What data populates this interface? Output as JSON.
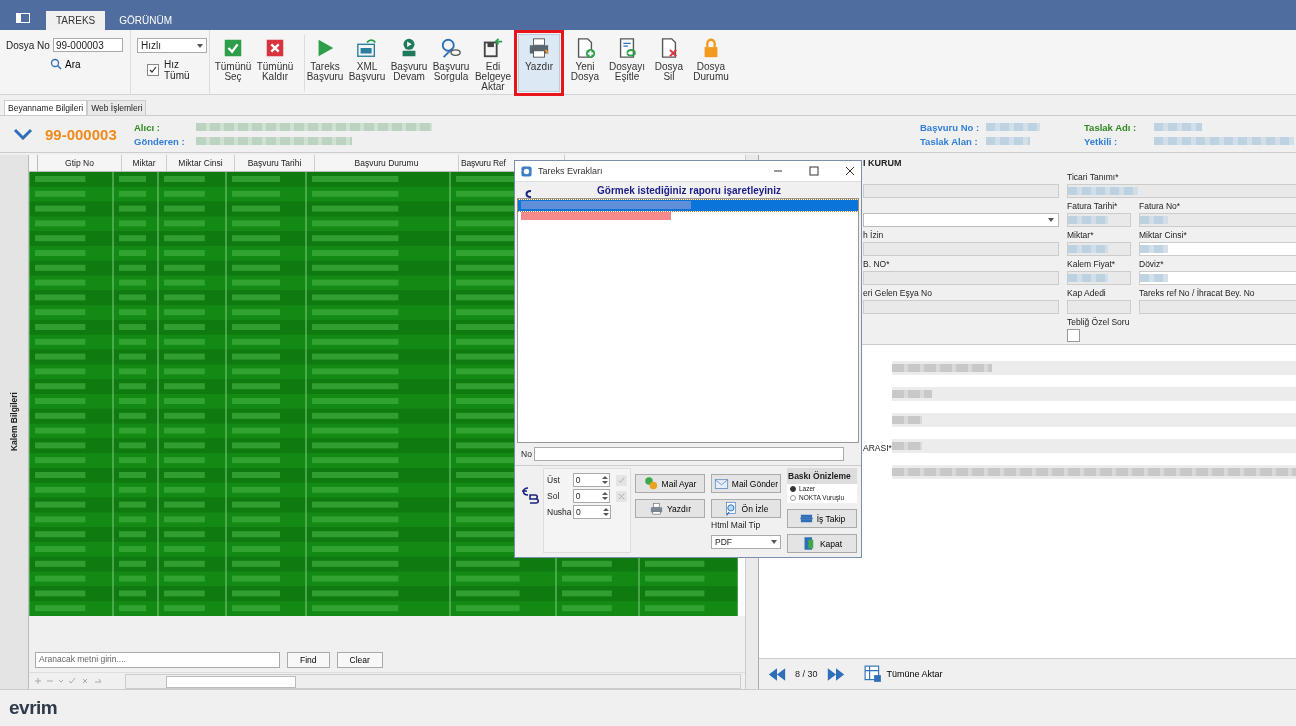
{
  "ribbon_tabs": [
    {
      "label": "TAREKS",
      "selected": true
    },
    {
      "label": "GÖRÜNÜM",
      "selected": false
    }
  ],
  "file_search": {
    "label": "Dosya No",
    "value": "99-000003",
    "search_label": "Ara"
  },
  "mode": {
    "value": "Hızlı",
    "checkbox_label": "Hız Tümü",
    "checked": true
  },
  "toolbar": [
    {
      "label": "Tümünü Seç",
      "highlighted": false
    },
    {
      "label": "Tümünü Kaldır",
      "highlighted": false
    },
    {
      "label": "Tareks Başvuru",
      "highlighted": false
    },
    {
      "label": "XML Başvuru",
      "highlighted": false
    },
    {
      "label": "Başvuru Devam",
      "highlighted": false
    },
    {
      "label": "Başvuru Sorgula",
      "highlighted": false
    },
    {
      "label": "Edi Belgeye Aktar",
      "highlighted": false
    },
    {
      "label": "Yazdır",
      "highlighted": true
    },
    {
      "label": "Yeni Dosya",
      "highlighted": false
    },
    {
      "label": "Dosyayı Eşitle",
      "highlighted": false
    },
    {
      "label": "Dosya Sil",
      "highlighted": false
    },
    {
      "label": "Dosya Durumu",
      "highlighted": false
    }
  ],
  "page_tabs": [
    {
      "label": "Beyanname Bilgileri",
      "selected": true
    },
    {
      "label": "Web İşlemleri",
      "selected": false
    }
  ],
  "header": {
    "file_no": "99-000003",
    "left_fields": [
      {
        "label": "Alıcı :",
        "color": "#2e8b1f"
      },
      {
        "label": "Gönderen :",
        "color": "#2f7fd8"
      }
    ],
    "right_fields": [
      {
        "label": "Başvuru No :",
        "color": "#2f7fd8"
      },
      {
        "label": "Taslak Alan :",
        "color": "#2f7fd8"
      },
      {
        "label": "Taslak Adı :",
        "color": "#2e8b1f"
      },
      {
        "label": "Yetkili :",
        "color": "#2f7fd8"
      }
    ]
  },
  "side_label": "Kalem Bilgileri",
  "grid": {
    "columns": [
      "Gtip No",
      "Miktar",
      "Miktar Cinsi",
      "Başvuru Tarihi",
      "Başvuru Durumu",
      "Başvuru Ref"
    ]
  },
  "search": {
    "placeholder": "Aranacak metni girin....",
    "buttons": [
      "Find",
      "Clear"
    ]
  },
  "form": {
    "section": "I KURUM",
    "trade_label": "Ticari Tanımı*",
    "left_labels": [
      "h İzin",
      "B. NO*",
      "eri Gelen Eşya No"
    ],
    "pairs": [
      [
        "Fatura Tarihi*",
        "Fatura No*"
      ],
      [
        "Miktar*",
        "Miktar Cinsi*"
      ],
      [
        "Kalem Fiyat*",
        "Döviz*"
      ],
      [
        "Kap Adedi",
        "Tareks ref No / İhracat Bey. No"
      ]
    ],
    "special_label": "Tebliğ Özel Soru",
    "special_checked": false
  },
  "lower_label": "ARASI*",
  "pager": {
    "reading": "8 / 30",
    "action": "Tümüne Aktar"
  },
  "brand": "evrim",
  "dialog": {
    "title": "Tareks Evrakları",
    "heading": "Görmek istediğiniz raporu işaretleyiniz",
    "reports": [
      {
        "selected": true,
        "color": "#5f8fd8"
      },
      {
        "selected": false,
        "color": "#f48a8a"
      }
    ],
    "no_label": "No",
    "spinners": [
      {
        "label": "Üst",
        "value": "0"
      },
      {
        "label": "Sol",
        "value": "0"
      },
      {
        "label": "Nusha",
        "value": "0"
      }
    ],
    "buttons": [
      "Mail Ayar",
      "Mail Gönder",
      "Yazdır",
      "Ön İzle",
      "İş Takip",
      "Kapat"
    ],
    "preview_title": "Baskı Önizleme",
    "printer_options": [
      {
        "label": "Lazer",
        "selected": true
      },
      {
        "label": "NOKTA Vuruşlu",
        "selected": false
      }
    ],
    "mail_type_label": "Html Mail Tip",
    "mail_type": "PDF"
  }
}
